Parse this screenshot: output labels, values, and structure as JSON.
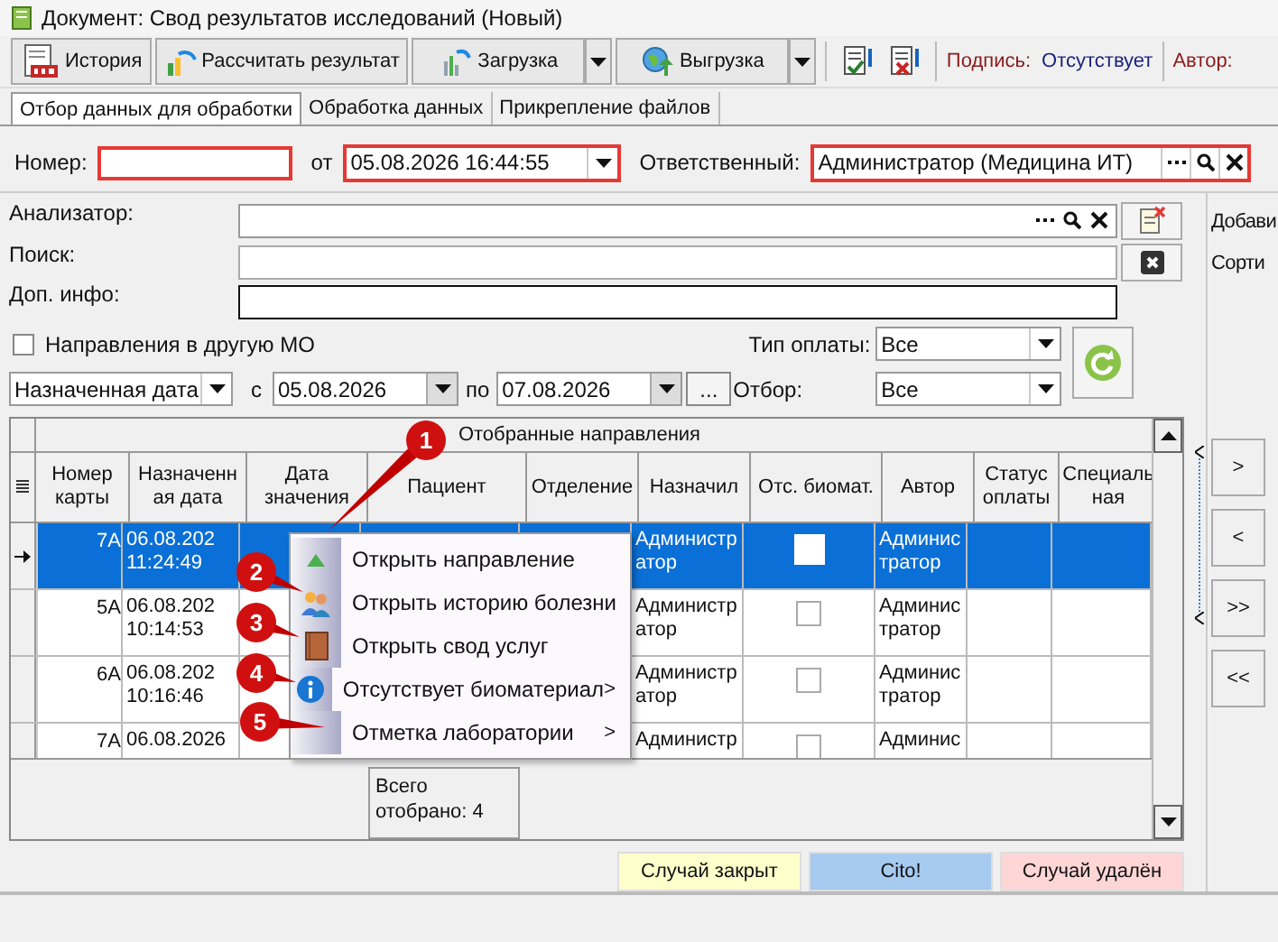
{
  "window": {
    "title": "Документ: Свод результатов исследований (Новый)"
  },
  "toolbar": {
    "buttons": [
      {
        "label": "История",
        "kind": "log",
        "dropdown": false
      },
      {
        "label": "Рассчитать результат",
        "kind": "calc",
        "dropdown": false
      },
      {
        "label": "Загрузка",
        "kind": "load",
        "dropdown": true
      },
      {
        "label": "Выгрузка",
        "kind": "export",
        "dropdown": true
      }
    ],
    "icon_buttons": [
      {
        "kind": "approve"
      },
      {
        "kind": "reject"
      }
    ],
    "signature_label": "Подпись:",
    "signature_value": "Отсутствует",
    "author_label": "Автор:"
  },
  "tabs": [
    {
      "label": "Отбор данных для обработки",
      "selected": true
    },
    {
      "label": "Обработка данных",
      "selected": false
    },
    {
      "label": "Прикрепление файлов",
      "selected": false
    }
  ],
  "header": {
    "number_label": "Номер:",
    "from_label": "от",
    "date": "05.08.2026 16:44:55",
    "responsible_label": "Ответственный:",
    "responsible": "Администратор (Медицина ИТ)"
  },
  "filters": {
    "analyzer_label": "Анализатор:",
    "search_label": "Поиск:",
    "extra_label": "Доп. инфо:",
    "other_mo": {
      "label": "Направления в другую МО",
      "checked": false
    },
    "payment_label": "Тип оплаты:",
    "payment": "Все",
    "date_type": "Назначенная дата",
    "from_label": "с",
    "date_from": "05.08.2026",
    "to_label": "по",
    "date_to": "07.08.2026",
    "more": "...",
    "selection_label": "Отбор:",
    "selection": "Все"
  },
  "table": {
    "group_title": "Отобранные направления",
    "columns": [
      "Номер карты",
      "Назначенн ая дата",
      "Дата значения",
      "Пациент",
      "Отделение",
      "Назначил",
      "Отс. биомат.",
      "Автор",
      "Статус оплаты",
      "Специаль ная"
    ],
    "rows": [
      {
        "selected": true,
        "card": "7А",
        "assigned": "06.08.202\n11:24:49",
        "by": "Администр\nатор",
        "biomat": false,
        "author": "Админис\nтратор"
      },
      {
        "selected": false,
        "card": "5А",
        "assigned": "06.08.202\n10:14:53",
        "by": "Администр\nатор",
        "biomat": false,
        "author": "Админис\nтратор"
      },
      {
        "selected": false,
        "card": "6А",
        "assigned": "06.08.202\n10:16:46",
        "by": "Администр\nатор",
        "biomat": false,
        "author": "Админис\nтратор"
      },
      {
        "selected": false,
        "card": "7А",
        "assigned": "06.08.2026",
        "by": "Администр",
        "biomat": false,
        "author": "Админис"
      }
    ],
    "total": "Всего отобрано: 4"
  },
  "context_menu": {
    "items": [
      {
        "label": "Открыть направление",
        "kind": "referral",
        "submenu": false
      },
      {
        "label": "Открыть историю болезни",
        "kind": "history",
        "submenu": false
      },
      {
        "label": "Открыть свод услуг",
        "kind": "book",
        "submenu": false
      },
      {
        "label": "Отсутствует биоматериал",
        "kind": "info",
        "submenu": true
      },
      {
        "label": "Отметка лаборатории",
        "kind": "none",
        "submenu": true
      }
    ],
    "submenu_mark": ">"
  },
  "callouts": [
    "1",
    "2",
    "3",
    "4",
    "5"
  ],
  "legend": [
    {
      "label": "Случай закрыт",
      "color": "#ffffcc"
    },
    {
      "label": "Cito!",
      "color": "#a6caf0"
    },
    {
      "label": "Случай удалён",
      "color": "#ffd6d6"
    }
  ],
  "side_panel": {
    "labels": [
      "Добави",
      "Сорти"
    ],
    "buttons": [
      ">",
      "<",
      ">>",
      "<<"
    ]
  }
}
